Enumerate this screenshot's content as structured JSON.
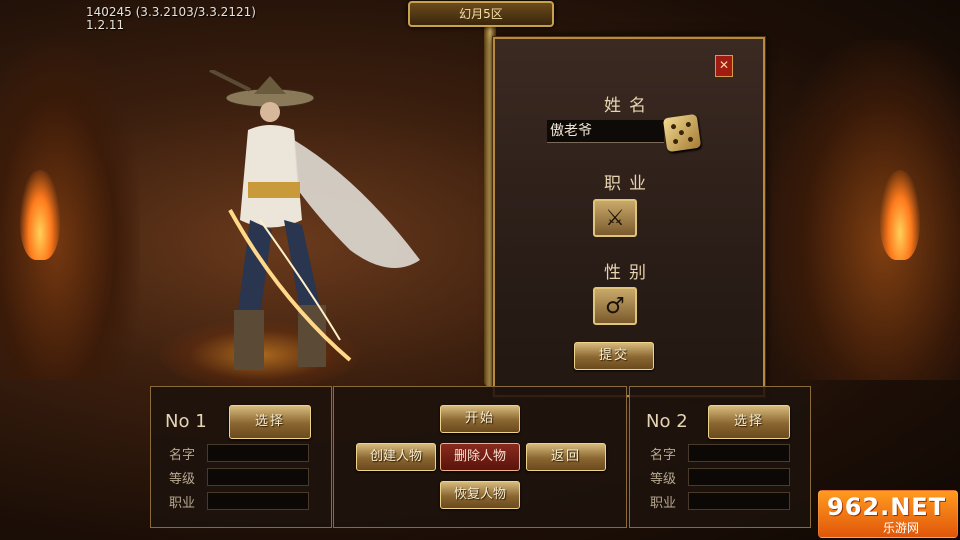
{
  "version": {
    "line1": "140245 (3.3.2103/3.3.2121)",
    "line2": "1.2.11"
  },
  "server": {
    "name": "幻月5区"
  },
  "create_dialog": {
    "close_label": "✕",
    "name_label": "姓名",
    "name_value": "傲老爷",
    "class_label": "职业",
    "gender_label": "性别",
    "gender_icon": "♂",
    "class_icon": "⚔",
    "submit_label": "提交"
  },
  "slot1": {
    "no_label": "No",
    "no_value": "1",
    "select_label": "选择",
    "fields": [
      "名字",
      "等级",
      "职业"
    ]
  },
  "slot2": {
    "no_label": "No",
    "no_value": "2",
    "select_label": "选择",
    "fields": [
      "名字",
      "等级",
      "职业"
    ]
  },
  "actions": {
    "start": "开始",
    "create": "创建人物",
    "delete": "删除人物",
    "back": "返回",
    "restore": "恢复人物"
  },
  "watermark": {
    "main": "962.NET",
    "sub": "乐游网"
  },
  "colors": {
    "gold": "#c9a24f",
    "delete_red": "#8a2a1e",
    "dialog_bg": "#2a1d17"
  }
}
